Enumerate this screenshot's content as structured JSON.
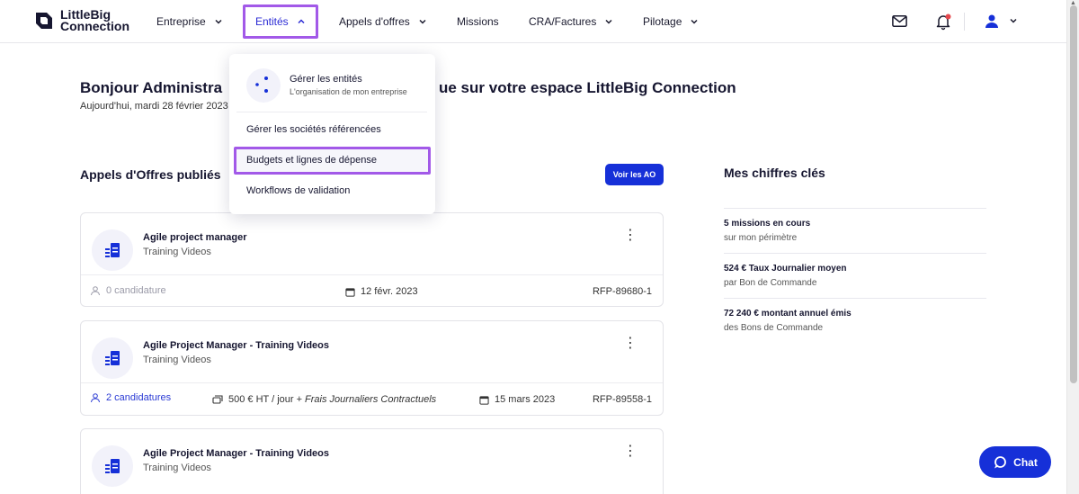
{
  "brand": {
    "line1": "LittleBig",
    "line2": "Connection"
  },
  "nav": {
    "items": [
      {
        "label": "Entreprise"
      },
      {
        "label": "Entités"
      },
      {
        "label": "Appels d'offres"
      },
      {
        "label": "Missions"
      },
      {
        "label": "CRA/Factures"
      },
      {
        "label": "Pilotage"
      }
    ]
  },
  "greeting": {
    "left": "Bonjour Administra",
    "right": "ue sur votre espace LittleBig Connection",
    "date": "Aujourd'hui, mardi 28 février 2023"
  },
  "dropdown": {
    "hero_title": "Gérer les entités",
    "hero_sub": "L'organisation de mon entreprise",
    "items": [
      {
        "label": "Gérer les sociétés référencées"
      },
      {
        "label": "Budgets et lignes de dépense"
      },
      {
        "label": "Workflows de validation"
      }
    ]
  },
  "ao_section": {
    "title": "Appels d'Offres publiés",
    "button": "Voir les AO"
  },
  "cards": [
    {
      "title": "Agile project manager",
      "subtitle": "Training Videos",
      "candidates": "0 candidature",
      "date": "12 févr. 2023",
      "ref": "RFP-89680-1"
    },
    {
      "title": "Agile Project Manager - Training Videos",
      "subtitle": "Training Videos",
      "candidates": "2 candidatures",
      "rate": "500 € HT / jour +",
      "rate_extra": "Frais Journaliers Contractuels",
      "date": "15 mars 2023",
      "ref": "RFP-89558-1"
    },
    {
      "title": "Agile Project Manager - Training Videos",
      "subtitle": "Training Videos"
    }
  ],
  "kpis": {
    "title": "Mes chiffres clés",
    "items": [
      {
        "value": "5 missions en cours",
        "label": "sur mon périmètre"
      },
      {
        "value": "524 € Taux Journalier moyen",
        "label": "par Bon de Commande"
      },
      {
        "value": "72 240 € montant annuel émis",
        "label": "des Bons de Commande"
      }
    ]
  },
  "chat": {
    "label": "Chat"
  },
  "colors": {
    "primary": "#1630d8",
    "highlight": "#a259e8",
    "notification": "#e5484d"
  }
}
